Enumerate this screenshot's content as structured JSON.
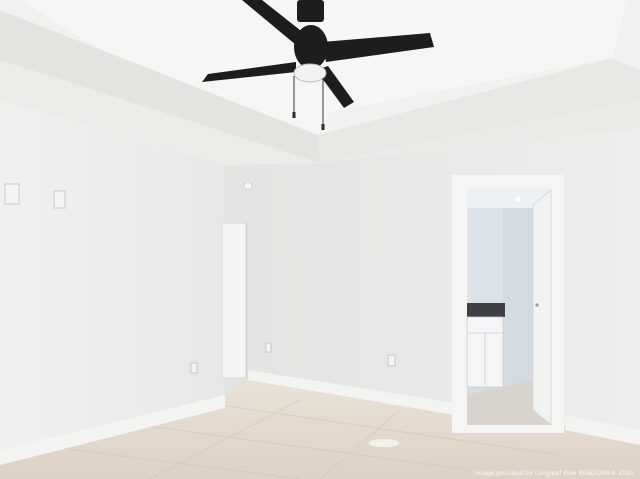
{
  "photo": {
    "subject": "empty-bedroom",
    "watermark": "Image provided by Longleaf Pine REALTORS® 2025"
  },
  "colors": {
    "ceiling": "#f3f3f1",
    "wall_left": "#ecedeb",
    "wall_back": "#e6e7e5",
    "floor": "#e4dcd0",
    "fan": "#1d1d1f"
  }
}
